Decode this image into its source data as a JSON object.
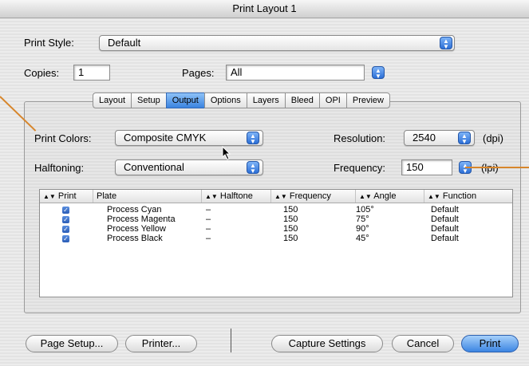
{
  "window": {
    "title": "Print Layout 1"
  },
  "print_style": {
    "label": "Print Style:",
    "value": "Default"
  },
  "copies": {
    "label": "Copies:",
    "value": "1"
  },
  "pages": {
    "label": "Pages:",
    "value": "All"
  },
  "tabs": [
    "Layout",
    "Setup",
    "Output",
    "Options",
    "Layers",
    "Bleed",
    "OPI",
    "Preview"
  ],
  "active_tab": "Output",
  "output": {
    "print_colors_label": "Print Colors:",
    "print_colors_value": "Composite CMYK",
    "halftoning_label": "Halftoning:",
    "halftoning_value": "Conventional",
    "resolution_label": "Resolution:",
    "resolution_value": "2540",
    "resolution_unit": "(dpi)",
    "frequency_label": "Frequency:",
    "frequency_value": "150",
    "frequency_unit": "(lpi)"
  },
  "table": {
    "headers": [
      "Print",
      "Plate",
      "Halftone",
      "Frequency",
      "Angle",
      "Function"
    ],
    "rows": [
      {
        "plate": "Process Cyan",
        "halftone": "–",
        "frequency": "150",
        "angle": "105°",
        "function": "Default"
      },
      {
        "plate": "Process Magenta",
        "halftone": "–",
        "frequency": "150",
        "angle": "75°",
        "function": "Default"
      },
      {
        "plate": "Process Yellow",
        "halftone": "–",
        "frequency": "150",
        "angle": "90°",
        "function": "Default"
      },
      {
        "plate": "Process Black",
        "halftone": "–",
        "frequency": "150",
        "angle": "45°",
        "function": "Default"
      }
    ]
  },
  "buttons": {
    "page_setup": "Page Setup...",
    "printer": "Printer...",
    "capture_settings": "Capture Settings",
    "cancel": "Cancel",
    "print": "Print"
  },
  "colors": {
    "accent": "#3a83e0",
    "annotation": "#d7862c"
  },
  "icons": {
    "stepper": "up-down-arrows-icon",
    "sort": "sort-arrows-icon",
    "checkbox": "checkmark-icon",
    "cursor": "mouse-pointer-icon"
  }
}
